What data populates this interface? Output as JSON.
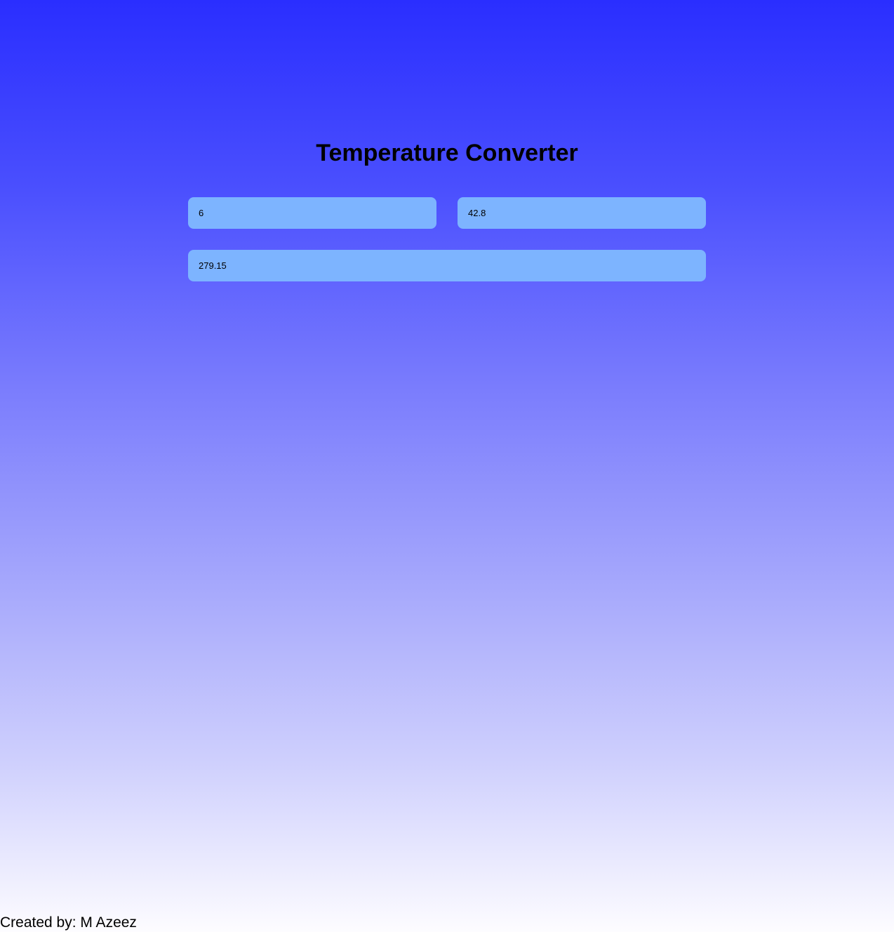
{
  "page": {
    "title": "Temperature Converter",
    "gradient_colors": [
      "#2a2eff",
      "#fdfcff"
    ]
  },
  "inputs": {
    "celsius": {
      "value": "6"
    },
    "fahrenheit": {
      "value": "42.8"
    },
    "kelvin": {
      "value": "279.15"
    },
    "fill_color": "#7db4ff"
  },
  "footer": {
    "text": "Created by: M Azeez"
  }
}
